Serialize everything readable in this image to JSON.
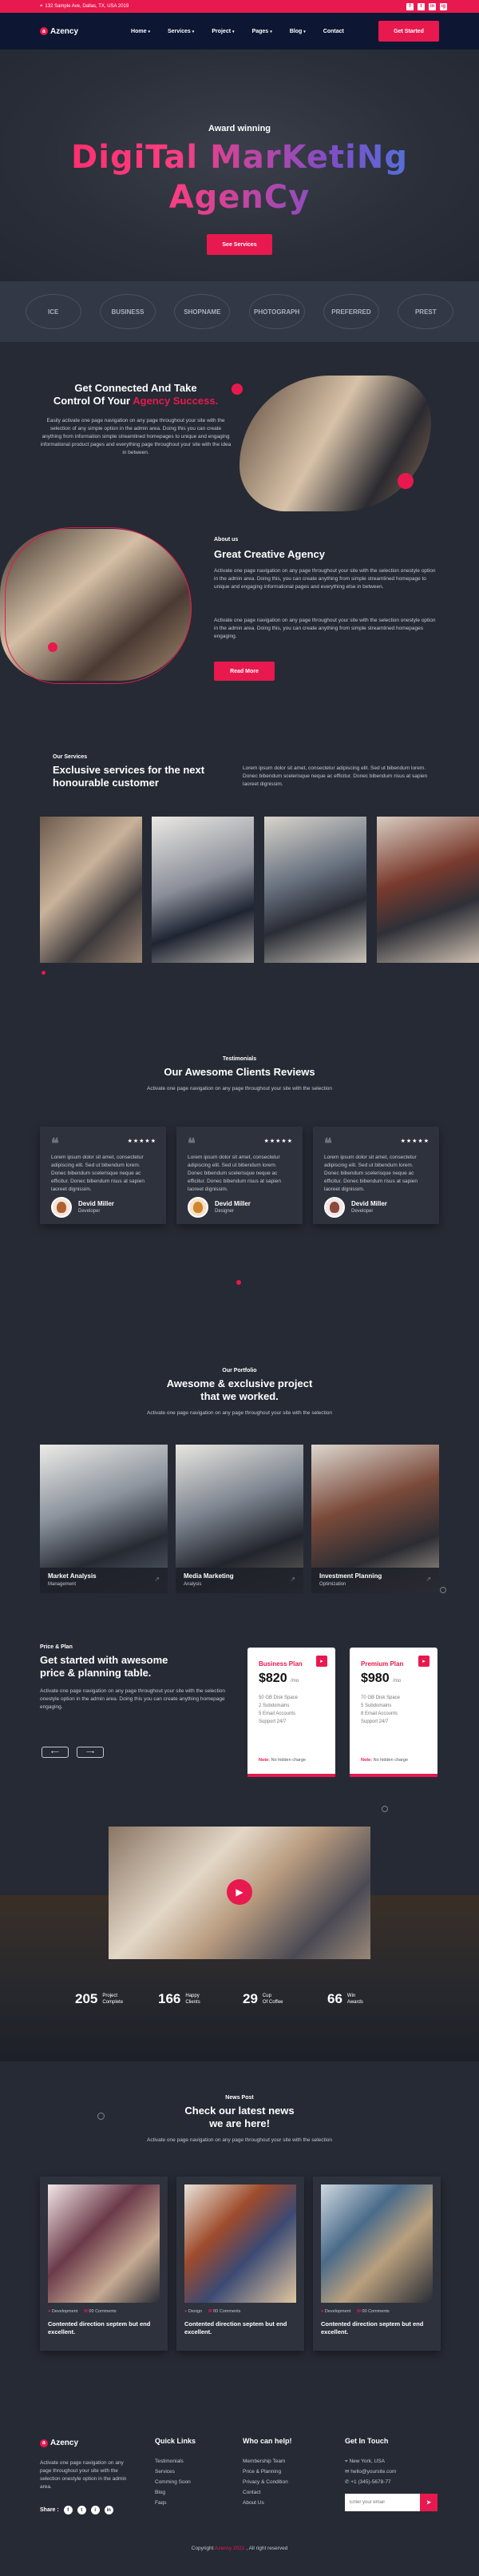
{
  "topbar": {
    "address": "132 Sample Ave, Dallas, TX, USA 2019",
    "socials": [
      "f",
      "t",
      "in",
      "ig"
    ]
  },
  "nav": {
    "brand": "Azency",
    "menu": [
      "Home",
      "Services",
      "Project",
      "Pages",
      "Blog",
      "Contact"
    ],
    "cta": "Get Started"
  },
  "hero": {
    "eyebrow": "Award winning",
    "title_line1": "DigiTal MarKetiNg",
    "title_line2": "AgenCy",
    "button": "See Services"
  },
  "logos": [
    "ICE",
    "BUSINESS",
    "SHOPNAME",
    "PHOTOGRAPH",
    "PREFERRED",
    "PREST"
  ],
  "connect": {
    "title_a": "Get Connected And Take",
    "title_b": "Control Of Your ",
    "title_accent": "Agency Success.",
    "body": "Easily activate one page navigation on any page throughout your site with the selection of any simple option in the admin area. Doing this you can create anything from information simple streamlined homepages to unique and engaging informational product pages and everything page throughout your site with the idea in between."
  },
  "about": {
    "eyebrow": "About us",
    "title": "Great Creative Agency",
    "para1": "Activate one page navigation on any page throughout your site with the selection onestyle option in the admin area. Doing this, you can create anything from simple streamlined homepage to unique and engaging informational pages and everything else in between.",
    "para2": "Activate one page navigation on any page throughout your site with the selection onestyle option in the admin area. Doing this, you can create anything from simple streamlined homepages engaging.",
    "button": "Read More"
  },
  "services": {
    "eyebrow": "Our Services",
    "title_line1": "Exclusive services for the next",
    "title_line2": "honourable customer",
    "body": "Lorem ipsum dolor sit amet, consectetur adipiscing elit. Sed ut bibendum lorem. Donec bibendum scelerisque neque ac efficitur. Donec bibendum risus at sapien laoreet dignissim."
  },
  "testimonials": {
    "eyebrow": "Testimonials",
    "title": "Our Awesome Clients Reviews",
    "sub": "Activate one page navigation on any page throughout your site with the selection",
    "items": [
      {
        "text": "Lorem ipsum dolor sit amet, consectetur adipiscing elit. Sed ut bibendum lorem. Donec bibendum scelerisque neque ac efficitur. Donec bibendum risus at sapien laoreet dignissim.",
        "name": "Devid Miller",
        "role": "Developer"
      },
      {
        "text": "Lorem ipsum dolor sit amet, consectetur adipiscing elit. Sed ut bibendum lorem. Donec bibendum scelerisque neque ac efficitur. Donec bibendum risus at sapien laoreet dignissim.",
        "name": "Devid Miller",
        "role": "Designer"
      },
      {
        "text": "Lorem ipsum dolor sit amet, consectetur adipiscing elit. Sed ut bibendum lorem. Donec bibendum scelerisque neque ac efficitur. Donec bibendum risus at sapien laoreet dignissim.",
        "name": "Devid Miller",
        "role": "Developer"
      }
    ]
  },
  "portfolio": {
    "eyebrow": "Our Portfolio",
    "title_line1": "Awesome & exclusive project",
    "title_line2": "that we worked.",
    "sub": "Activate one page navigation on any page throughout your site with the selection",
    "items": [
      {
        "title": "Market Analysis",
        "cat": "Management"
      },
      {
        "title": "Media Marketing",
        "cat": "Analysis"
      },
      {
        "title": "Investment Planning",
        "cat": "Optimization"
      }
    ]
  },
  "pricing": {
    "eyebrow": "Price & Plan",
    "title_line1": "Get started with awesome",
    "title_line2": "price & planning table.",
    "body": "Activate one page navigation on any page throughout your site with the selection onestyle option in the admin area. Doing this you can create anything homepage engaging.",
    "plans": [
      {
        "name": "Business Plan",
        "price": "$820",
        "per": "/mo",
        "features": [
          "50 GB Disk Space",
          "2 Subdomains",
          "5 Email Accounts",
          "Support 24/7"
        ],
        "note_label": "Note:",
        "note": " No hidden charge"
      },
      {
        "name": "Premium Plan",
        "price": "$980",
        "per": "/mo",
        "features": [
          "70 GB Disk Space",
          "5 Subdomains",
          "8 Email Accounts",
          "Support 24/7"
        ],
        "note_label": "Note:",
        "note": " No hidden charge"
      }
    ]
  },
  "stats": [
    {
      "n": "205",
      "l1": "Project",
      "l2": "Complete"
    },
    {
      "n": "166",
      "l1": "Happy",
      "l2": "Clients"
    },
    {
      "n": "29",
      "l1": "Cup",
      "l2": "Of Coffee"
    },
    {
      "n": "66",
      "l1": "Win",
      "l2": "Awards"
    }
  ],
  "news": {
    "eyebrow": "News Post",
    "title_line1": "Check our latest news",
    "title_line2": "we are here!",
    "sub": "Activate one page navigation on any page throughout your site with the selection",
    "items": [
      {
        "cat": "Development",
        "comments": "00 Comments",
        "title": "Contented direction septem but end excellent."
      },
      {
        "cat": "Design",
        "comments": "00 Comments",
        "title": "Contented direction septem but end excellent."
      },
      {
        "cat": "Development",
        "comments": "00 Comments",
        "title": "Contented direction septem but end excellent."
      }
    ]
  },
  "footer": {
    "brand": "Azency",
    "about": "Activate one page navigation on any page throughout your site with the selection onestyle option in the admin area.",
    "share_label": "Share :",
    "quick_title": "Quick Links",
    "quick": [
      "Testimonials",
      "Services",
      "Comming Soon",
      "Blog",
      "Faqs"
    ],
    "help_title": "Who can help!",
    "help": [
      "Membership Team",
      "Price & Planning",
      "Privacy & Condition",
      "Contact",
      "About Us"
    ],
    "touch_title": "Get In Touch",
    "touch": [
      "New York, USA",
      "hello@yoursite.com",
      "+1 (345)-5678-77"
    ],
    "email_placeholder": "Enter your email",
    "copy_a": "Copyright ",
    "copy_accent": "Azency 2021",
    "copy_b": " , All right reserved"
  },
  "colors": {
    "accent": "#e8194e",
    "bg": "#262a34",
    "nav": "#0d1733"
  }
}
